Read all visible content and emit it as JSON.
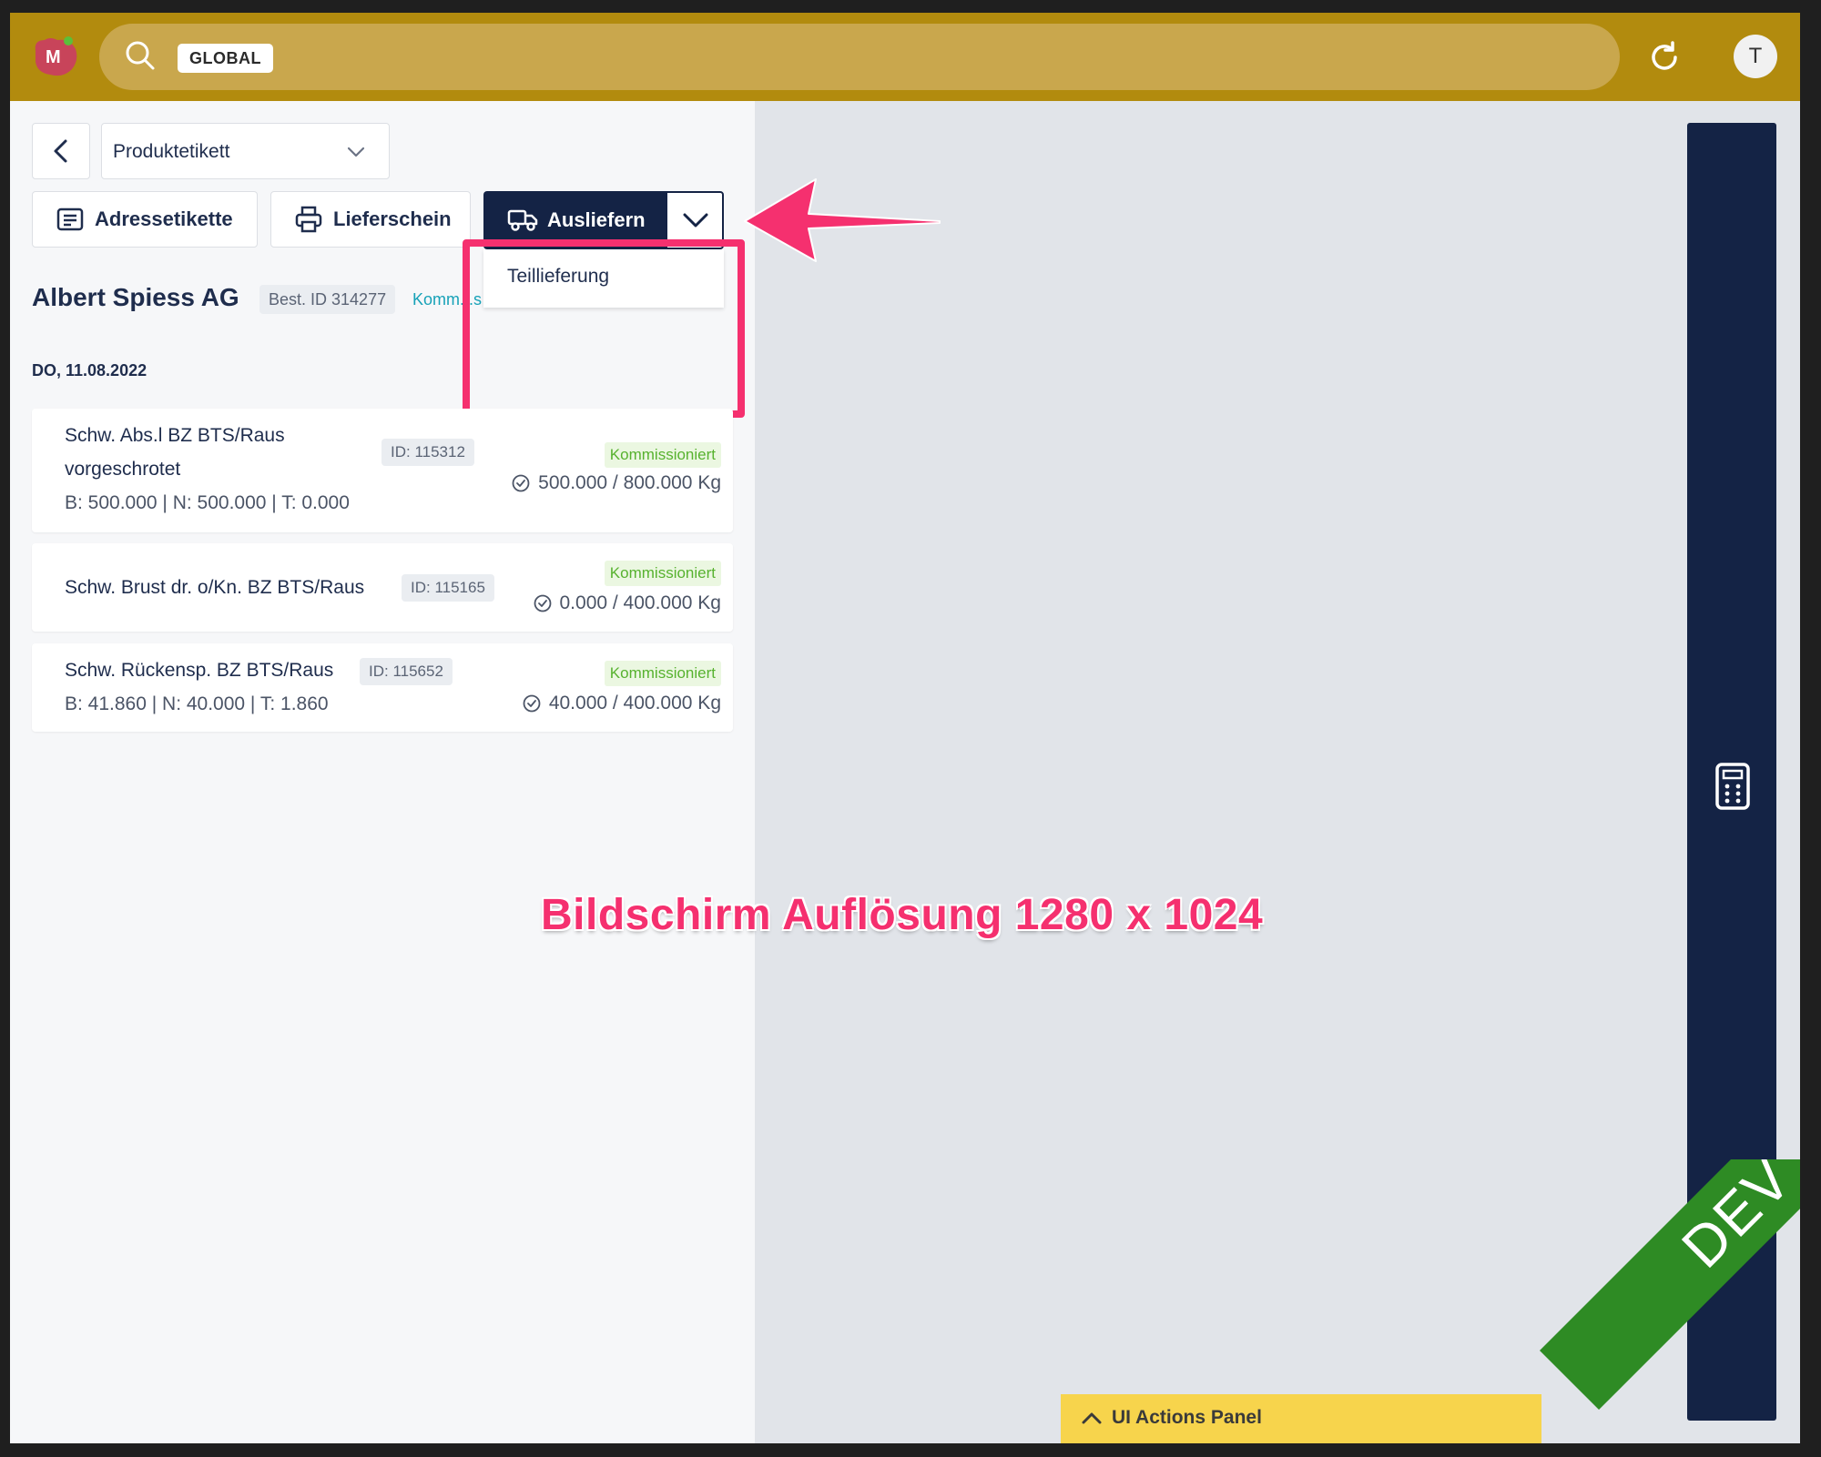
{
  "topbar": {
    "search_scope": "GLOBAL",
    "avatar_initial": "T"
  },
  "toolbar": {
    "product_select_value": "Produktetikett",
    "adresse_label": "Adressetikette",
    "liefer_label": "Lieferschein",
    "ausliefern_label": "Ausliefern",
    "dropdown_item": "Teillieferung"
  },
  "order": {
    "customer": "Albert Spiess AG",
    "order_id": "Best. ID 314277",
    "status_link": "Komm...s",
    "date": "DO, 11.08.2022"
  },
  "items": [
    {
      "name_line1": "Schw. Abs.l BZ BTS/Raus",
      "name_line2": "vorgeschrotet",
      "id": "ID: 115312",
      "status": "Kommissioniert",
      "qty": "500.000 / 800.000 Kg",
      "nums": "B: 500.000 | N: 500.000 | T: 0.000"
    },
    {
      "name_line1": "Schw. Brust dr. o/Kn. BZ BTS/Raus",
      "id": "ID: 115165",
      "status": "Kommissioniert",
      "qty": "0.000 / 400.000 Kg"
    },
    {
      "name_line1": "Schw. Rückensp. BZ BTS/Raus",
      "id": "ID: 115652",
      "status": "Kommissioniert",
      "qty": "40.000 / 400.000 Kg",
      "nums": "B: 41.860 | N: 40.000 | T: 1.860"
    }
  ],
  "annotation": {
    "text": "Bildschirm Auflösung 1280 x 1024"
  },
  "ui_actions_panel": "UI Actions Panel",
  "ribbon": "DEV",
  "colors": {
    "topbar": "#b28b0e",
    "primary": "#142345",
    "accent_annotation": "#f5306f",
    "status_green": "#57b22f",
    "ribbon": "#2e8b24"
  }
}
